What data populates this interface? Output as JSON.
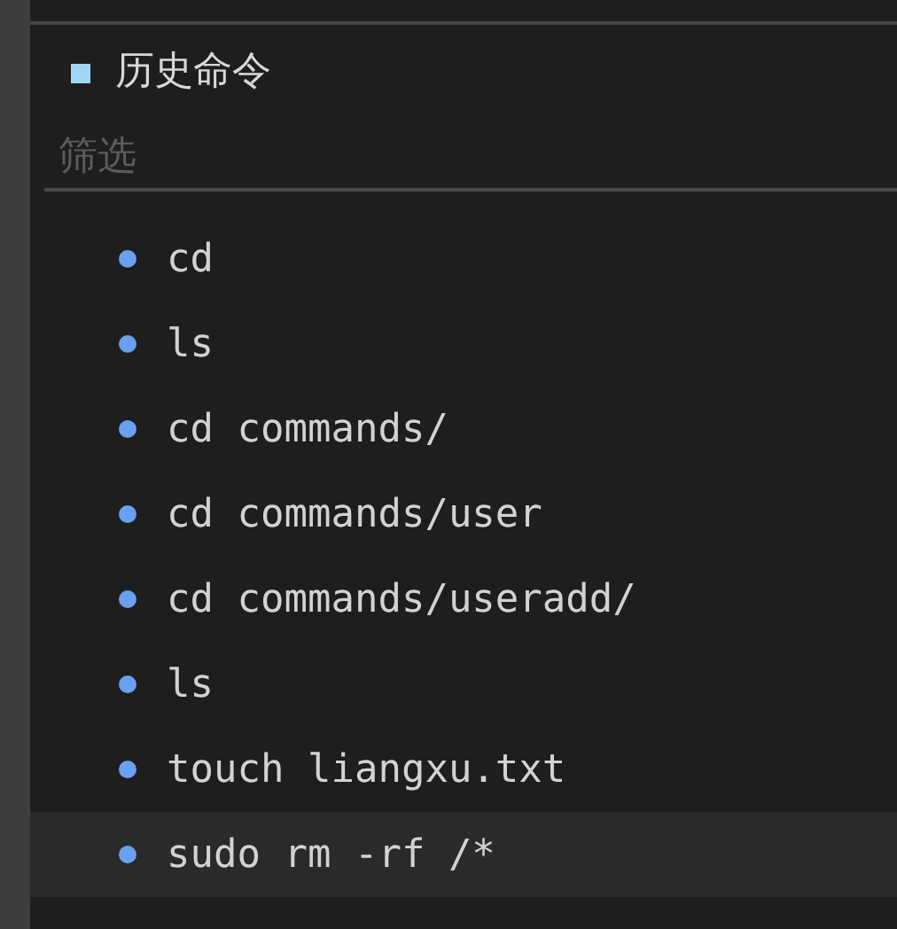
{
  "panel": {
    "title": "历史命令"
  },
  "filter": {
    "placeholder": "筛选"
  },
  "commands": [
    {
      "text": "cd",
      "selected": false
    },
    {
      "text": "ls",
      "selected": false
    },
    {
      "text": "cd commands/",
      "selected": false
    },
    {
      "text": "cd commands/user",
      "selected": false
    },
    {
      "text": "cd commands/useradd/",
      "selected": false
    },
    {
      "text": "ls",
      "selected": false
    },
    {
      "text": "touch liangxu.txt",
      "selected": false
    },
    {
      "text": "sudo rm -rf /*",
      "selected": true
    }
  ]
}
